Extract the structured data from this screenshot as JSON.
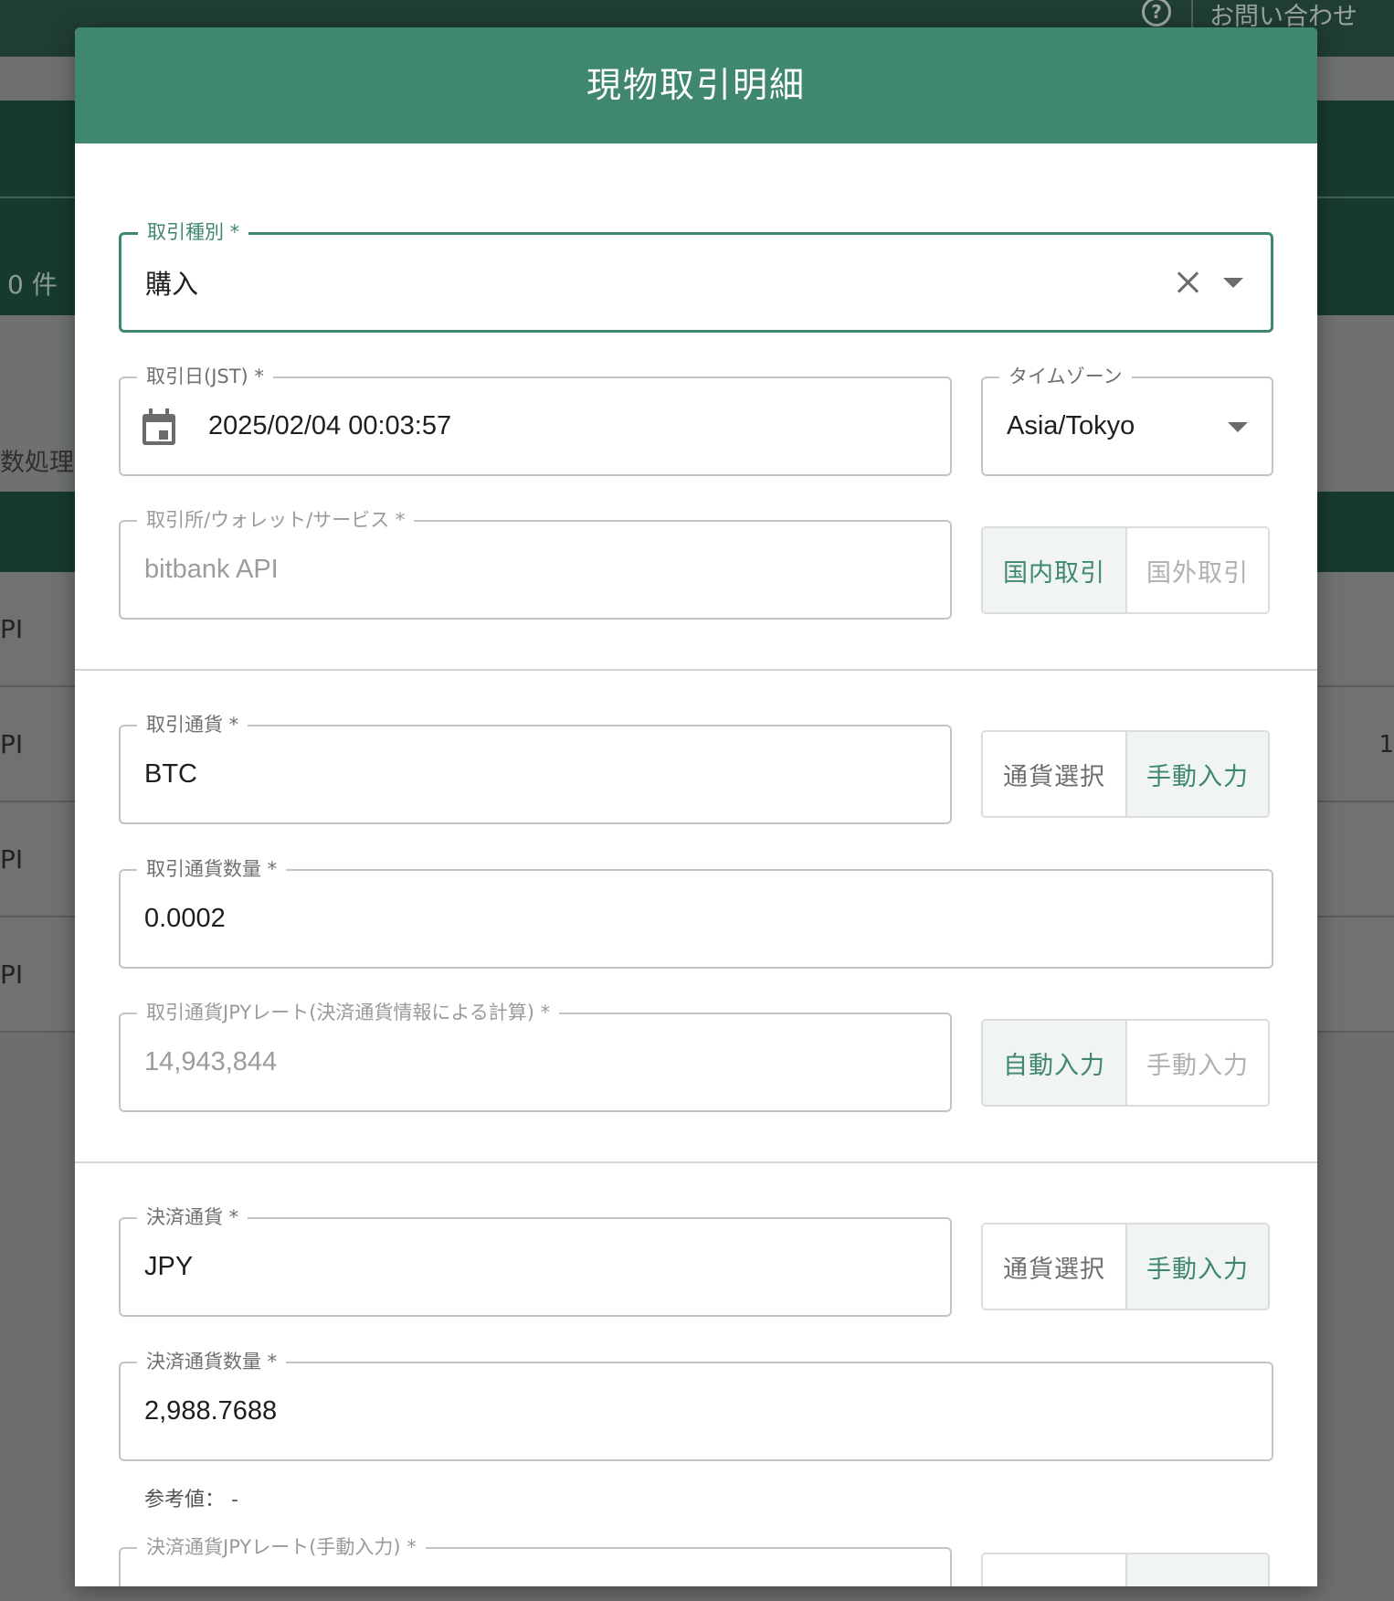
{
  "background": {
    "top_actions": {
      "help_icon": "question-circle-icon",
      "contact": "お問い合わせ"
    },
    "count_text": "0 件",
    "process_text": "数処理:",
    "row_labels": [
      "PI",
      "PI",
      "PI",
      "PI"
    ],
    "row_marker": "1"
  },
  "modal": {
    "title": "現物取引明細",
    "trade_type": {
      "label": "取引種別 *",
      "value": "購入"
    },
    "trade_date": {
      "label": "取引日(JST) *",
      "value": "2025/02/04 00:03:57"
    },
    "timezone": {
      "label": "タイムゾーン",
      "value": "Asia/Tokyo"
    },
    "exchange": {
      "label": "取引所/ウォレット/サービス *",
      "value": "bitbank API"
    },
    "exchange_toggle": {
      "domestic": "国内取引",
      "foreign": "国外取引"
    },
    "trade_currency": {
      "label": "取引通貨 *",
      "value": "BTC"
    },
    "trade_currency_toggle": {
      "select": "通貨選択",
      "manual": "手動入力"
    },
    "trade_amount": {
      "label": "取引通貨数量 *",
      "value": "0.0002"
    },
    "trade_rate": {
      "label": "取引通貨JPYレート(決済通貨情報による計算) *",
      "value": "14,943,844"
    },
    "trade_rate_toggle": {
      "auto": "自動入力",
      "manual": "手動入力"
    },
    "settle_currency": {
      "label": "決済通貨 *",
      "value": "JPY"
    },
    "settle_currency_toggle": {
      "select": "通貨選択",
      "manual": "手動入力"
    },
    "settle_amount": {
      "label": "決済通貨数量 *",
      "value": "2,988.7688"
    },
    "reference": "参考値： -",
    "settle_rate": {
      "label": "決済通貨JPYレート(手動入力) *"
    }
  },
  "colors": {
    "primary": "#3f8770",
    "header_bg": "#3f8770",
    "overlay": "#6a6d6b"
  }
}
